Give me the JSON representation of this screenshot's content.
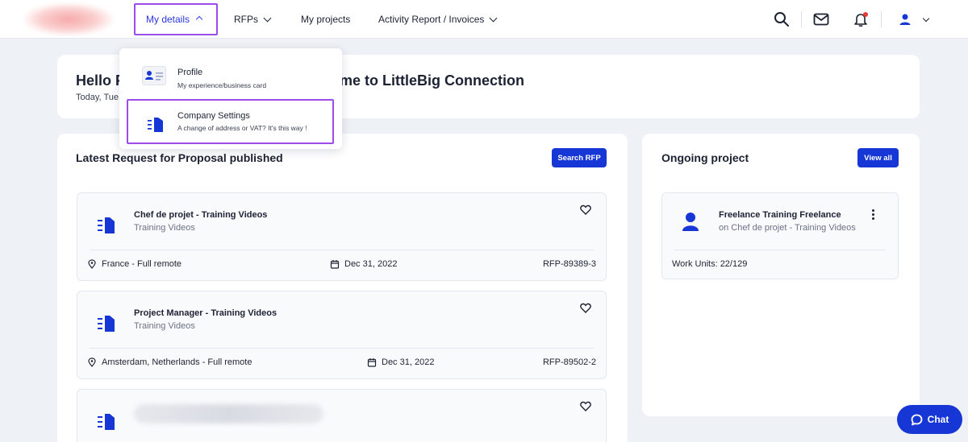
{
  "nav": {
    "items": [
      "My details",
      "RFPs",
      "My projects",
      "Activity Report / Invoices"
    ]
  },
  "menu": {
    "items": [
      {
        "title": "Profile",
        "subtitle": "My experience/business card"
      },
      {
        "title": "Company Settings",
        "subtitle": "A change of address or VAT? It's this way !"
      }
    ]
  },
  "hello": {
    "title_left": "Hello F",
    "title_right": "lcome to LittleBig Connection",
    "date": "Today, Tue"
  },
  "rfp_section": {
    "title": "Latest Request for Proposal published",
    "search_button": "Search RFP",
    "items": [
      {
        "title": "Chef de projet - Training Videos",
        "subtitle": "Training Videos",
        "location": "France - Full remote",
        "date": "Dec 31, 2022",
        "ref": "RFP-89389-3"
      },
      {
        "title": "Project Manager - Training Videos",
        "subtitle": "Training Videos",
        "location": "Amsterdam, Netherlands - Full remote",
        "date": "Dec 31, 2022",
        "ref": "RFP-89502-2"
      }
    ]
  },
  "ongoing": {
    "title": "Ongoing project",
    "view_all": "View all",
    "project_title": "Freelance Training Freelance",
    "project_sub": "on Chef de projet - Training Videos",
    "work_units": "Work Units: 22/129"
  },
  "chat_label": "Chat",
  "colors": {
    "accent": "#1636d6",
    "highlight": "#9b4dea",
    "notification": "#e53935"
  }
}
